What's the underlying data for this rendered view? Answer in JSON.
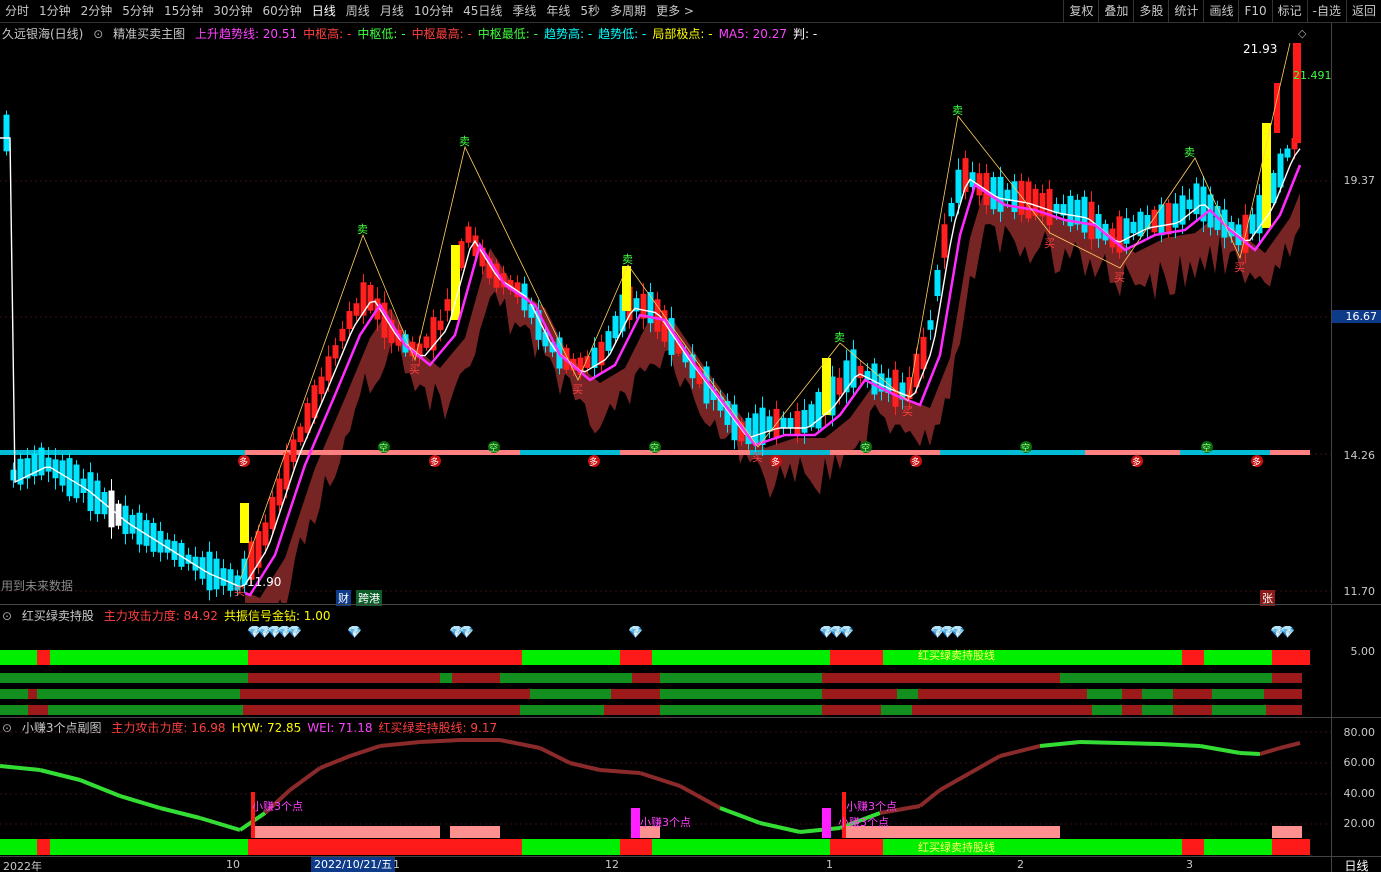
{
  "toolbar": {
    "periods": [
      "分时",
      "1分钟",
      "2分钟",
      "5分钟",
      "15分钟",
      "30分钟",
      "60分钟",
      "日线",
      "周线",
      "月线",
      "10分钟",
      "45日线",
      "季线",
      "年线",
      "5秒",
      "多周期",
      "更多 >"
    ],
    "active_period_index": 7,
    "tools": [
      "复权",
      "叠加",
      "多股",
      "统计",
      "画线",
      "F10",
      "标记",
      "-自选",
      "返回"
    ]
  },
  "main": {
    "stock": "久远银海(日线)",
    "indicator": "精准买卖主图",
    "params": [
      {
        "text": "上升趋势线: 20.51",
        "color": "#ff44ff"
      },
      {
        "text": "中枢高: -",
        "color": "#ff4040"
      },
      {
        "text": "中枢低: -",
        "color": "#40ff40"
      },
      {
        "text": "中枢最高: -",
        "color": "#ff4040"
      },
      {
        "text": "中枢最低: -",
        "color": "#40ff40"
      },
      {
        "text": "趋势高: -",
        "color": "#00ffff"
      },
      {
        "text": "趋势低: -",
        "color": "#00ffff"
      },
      {
        "text": "局部极点: -",
        "color": "#ffff00"
      },
      {
        "text": "MA5: 20.27",
        "color": "#ff44ff"
      },
      {
        "text": "判: -",
        "color": "#ffffff"
      }
    ],
    "price_labels": {
      "high": "21.93",
      "low": "11.90",
      "last": "21.491"
    },
    "future_data_note": "用到未来数据",
    "badges": {
      "cai": "财",
      "kuagang": "跨港",
      "zhang": "张"
    },
    "axis": [
      "19.37",
      "16.67",
      "14.26",
      "11.70"
    ],
    "signals": {
      "buy": "买",
      "sell": "卖",
      "long": "多",
      "short": "空"
    }
  },
  "panel2": {
    "title": "红买绿卖持股",
    "params": [
      {
        "text": "主力攻击力度: 84.92",
        "color": "#ff4040"
      },
      {
        "text": "共振信号金钻: 1.00",
        "color": "#ffff00"
      }
    ],
    "axis": [
      "5.00"
    ],
    "band_label": "红买绿卖持股线"
  },
  "panel3": {
    "title": "小赚3个点副图",
    "params": [
      {
        "text": "主力攻击力度: 16.98",
        "color": "#ff4040"
      },
      {
        "text": "HYW: 72.85",
        "color": "#ffff00"
      },
      {
        "text": "WEI: 71.18",
        "color": "#ff44ff"
      },
      {
        "text": "红买绿卖持股线: 9.17",
        "color": "#ff4040"
      }
    ],
    "axis": [
      "80.00",
      "60.00",
      "40.00",
      "20.00"
    ],
    "marker_label": "小赚3个点",
    "band_label": "红买绿卖持股线"
  },
  "bottom_axis": {
    "ticks": [
      "2022年",
      "10",
      "1",
      "12",
      "1",
      "2",
      "3"
    ],
    "crosshair_date": "2022/10/21/五",
    "period": "日线"
  },
  "colors": {
    "up": "#ff2020",
    "down": "#00e5ff",
    "bg": "#000000",
    "green_band": "#00ee00",
    "red_band": "#ff1a1a",
    "pink_band": "#ff8080",
    "cyan_line": "#00bcd4",
    "ma": "#ff2bff"
  },
  "chart_data": {
    "type": "candlestick",
    "axis_ticks": [
      19.37,
      16.67,
      14.26,
      11.7
    ],
    "high": 21.93,
    "low": 11.9,
    "last_price": 21.491
  }
}
